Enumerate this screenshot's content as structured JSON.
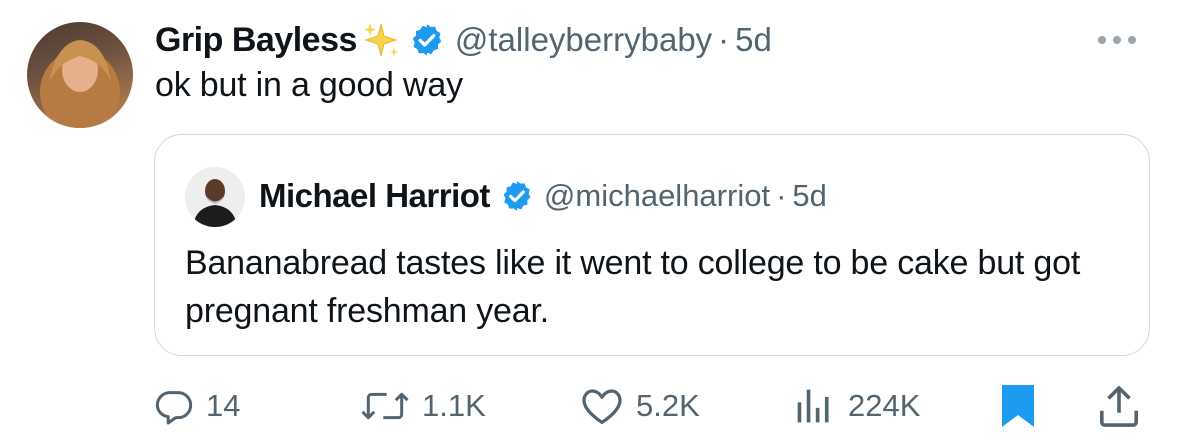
{
  "tweet": {
    "display_name": "Grip Bayless",
    "handle": "@talleyberrybaby",
    "separator": "·",
    "time": "5d",
    "text": "ok but in a good way"
  },
  "quoted_tweet": {
    "display_name": "Michael Harriot",
    "handle": "@michaelharriot",
    "separator": "·",
    "time": "5d",
    "text": "Bananabread tastes like it went to college to be cake but got pregnant freshman year."
  },
  "actions": {
    "replies": "14",
    "reposts": "1.1K",
    "likes": "5.2K",
    "views": "224K"
  },
  "colors": {
    "verified": "#1d9bf0",
    "bookmark": "#1d9bf0",
    "muted_text": "#536471",
    "border": "#cfd9de"
  },
  "icons": [
    "verified-badge-icon",
    "sparkles-icon",
    "more-icon",
    "reply-icon",
    "repost-icon",
    "like-icon",
    "views-icon",
    "bookmark-icon",
    "share-icon"
  ]
}
